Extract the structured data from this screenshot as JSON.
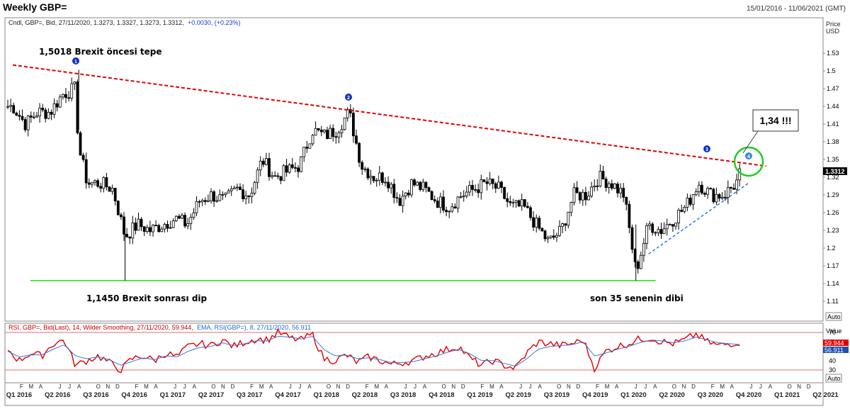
{
  "header": {
    "title": "Weekly GBP=",
    "date_range": "15/01/2016 - 11/06/2021 (GMT)",
    "info_line": "Cndl, GBP=, Bid, 27/11/2020, 1.3273, 1.3327, 1.3273, 1.3312,",
    "info_change": "+0.0030, (+0.23%)",
    "price_axis_label_1": "Price",
    "price_axis_label_2": "USD",
    "auto_label": "Auto"
  },
  "rsi_panel": {
    "info_line": "RSI, GBP=, Bid(Last),  14, Wilder Smoothing, 27/11/2020, 59.944,",
    "ema_line": "EMA, RSI(GBP=),  8, 27/11/2020, 56.911",
    "value_label": "Value",
    "auto_label": "Auto"
  },
  "annotations": {
    "peak_text": "1,5018 Brexit öncesi tepe",
    "dip_text": "1,1450 Brexit sonrası dip",
    "low35_text": "son 35 senenin dibi",
    "callout_text": "1,34 !!!",
    "markers": [
      "1",
      "2",
      "3",
      "4"
    ]
  },
  "colors": {
    "candle": "#000000",
    "resistance": "#e00000",
    "support_blue": "#1f6fd6",
    "support_green": "#33dd33",
    "circle": "#22cc22",
    "marker_blue": "#1030c0",
    "rsi_line": "#e00000",
    "ema_line": "#3a78d8",
    "last_price_bg": "#000000"
  },
  "chart_data": [
    {
      "type": "candlestick",
      "title": "Weekly GBP=",
      "ylabel": "Price USD",
      "y_ticks": [
        "1.53",
        "1.5",
        "1.47",
        "1.44",
        "1.41",
        "1.38",
        "1.35",
        "1.32",
        "1.29",
        "1.26",
        "1.23",
        "1.2",
        "1.17",
        "1.14",
        "1.11"
      ],
      "ylim": [
        1.1,
        1.56
      ],
      "last_price": "1.3312",
      "x_labels": [
        "Q1 2016",
        "F",
        "M",
        "A",
        "Q2 2016",
        "J",
        "J",
        "A",
        "Q3 2016",
        "O",
        "N",
        "D",
        "Q4 2016",
        "F",
        "M",
        "A",
        "Q1 2017",
        "J",
        "J",
        "A",
        "Q2 2017",
        "O",
        "N",
        "D",
        "Q3 2017",
        "F",
        "M",
        "A",
        "Q4 2017",
        "J",
        "J",
        "A",
        "Q1 2018",
        "O",
        "N",
        "D",
        "Q2 2018",
        "F",
        "M",
        "A",
        "Q3 2018",
        "J",
        "J",
        "A",
        "Q4 2018",
        "O",
        "N",
        "D",
        "Q1 2019",
        "F",
        "M",
        "A",
        "Q2 2019",
        "J",
        "J",
        "A",
        "Q3 2019",
        "O",
        "N",
        "D",
        "Q4 2019",
        "F",
        "M",
        "A",
        "Q1 2020",
        "J",
        "J",
        "A",
        "Q2 2020",
        "O",
        "N",
        "D",
        "Q3 2020",
        "F",
        "M",
        "A",
        "Q4 2020",
        "J",
        "J",
        "A",
        "Q1 2021",
        "O",
        "N",
        "D",
        "Q2 2021"
      ],
      "price_path": [
        [
          "2016-01",
          1.44
        ],
        [
          "2016-02",
          1.41
        ],
        [
          "2016-03",
          1.43
        ],
        [
          "2016-04",
          1.43
        ],
        [
          "2016-05",
          1.46
        ],
        [
          "2016-06",
          1.47
        ],
        [
          "2016-06-24",
          1.37
        ],
        [
          "2016-07",
          1.31
        ],
        [
          "2016-08",
          1.31
        ],
        [
          "2016-09",
          1.3
        ],
        [
          "2016-10",
          1.22
        ],
        [
          "2016-11",
          1.24
        ],
        [
          "2016-12",
          1.23
        ],
        [
          "2017-01",
          1.24
        ],
        [
          "2017-02",
          1.25
        ],
        [
          "2017-03",
          1.24
        ],
        [
          "2017-04",
          1.28
        ],
        [
          "2017-05",
          1.29
        ],
        [
          "2017-06",
          1.28
        ],
        [
          "2017-07",
          1.3
        ],
        [
          "2017-08",
          1.29
        ],
        [
          "2017-09",
          1.35
        ],
        [
          "2017-10",
          1.32
        ],
        [
          "2017-11",
          1.33
        ],
        [
          "2017-12",
          1.34
        ],
        [
          "2018-01",
          1.4
        ],
        [
          "2018-02",
          1.39
        ],
        [
          "2018-03",
          1.4
        ],
        [
          "2018-04",
          1.43
        ],
        [
          "2018-05",
          1.34
        ],
        [
          "2018-06",
          1.32
        ],
        [
          "2018-07",
          1.32
        ],
        [
          "2018-08",
          1.28
        ],
        [
          "2018-09",
          1.31
        ],
        [
          "2018-10",
          1.3
        ],
        [
          "2018-11",
          1.28
        ],
        [
          "2018-12",
          1.27
        ],
        [
          "2019-01",
          1.29
        ],
        [
          "2019-02",
          1.3
        ],
        [
          "2019-03",
          1.31
        ],
        [
          "2019-04",
          1.3
        ],
        [
          "2019-05",
          1.27
        ],
        [
          "2019-06",
          1.27
        ],
        [
          "2019-07",
          1.24
        ],
        [
          "2019-08",
          1.21
        ],
        [
          "2019-09",
          1.23
        ],
        [
          "2019-10",
          1.29
        ],
        [
          "2019-11",
          1.29
        ],
        [
          "2019-12",
          1.32
        ],
        [
          "2020-01",
          1.31
        ],
        [
          "2020-02",
          1.29
        ],
        [
          "2020-03",
          1.16
        ],
        [
          "2020-04",
          1.24
        ],
        [
          "2020-05",
          1.23
        ],
        [
          "2020-06",
          1.25
        ],
        [
          "2020-07",
          1.27
        ],
        [
          "2020-08",
          1.31
        ],
        [
          "2020-09",
          1.29
        ],
        [
          "2020-10",
          1.29
        ],
        [
          "2020-11",
          1.31
        ],
        [
          "2020-11-27",
          1.3312
        ]
      ],
      "extremes": {
        "high": 1.5018,
        "low": 1.145
      },
      "trendlines": [
        {
          "style": "dashed-red",
          "from": [
            "2016-01",
            1.51
          ],
          "to": [
            "2020-12",
            1.34
          ]
        },
        {
          "style": "dashed-blue",
          "from": [
            "2020-04",
            1.19
          ],
          "to": [
            "2020-12",
            1.31
          ]
        },
        {
          "style": "solid-green",
          "from": [
            "2016-05",
            1.145
          ],
          "to": [
            "2020-04",
            1.145
          ]
        }
      ]
    },
    {
      "type": "line",
      "title": "RSI",
      "y_ticks": [
        "70",
        "60",
        "40",
        "30"
      ],
      "ylim": [
        20,
        80
      ],
      "reference_lines": [
        70,
        30
      ],
      "series": [
        {
          "name": "RSI",
          "last": "59.944",
          "values": [
            52,
            40,
            48,
            45,
            58,
            62,
            35,
            40,
            45,
            38,
            30,
            42,
            45,
            40,
            48,
            44,
            55,
            58,
            56,
            62,
            55,
            60,
            63,
            62,
            70,
            64,
            62,
            68,
            42,
            40,
            46,
            38,
            44,
            40,
            36,
            38,
            40,
            45,
            48,
            52,
            55,
            42,
            35,
            40,
            35,
            32,
            48,
            60,
            58,
            56,
            58,
            62,
            32,
            50,
            55,
            58,
            63,
            64,
            60,
            58,
            62,
            68,
            60,
            56,
            58,
            60
          ]
        },
        {
          "name": "EMA",
          "last": "56.911",
          "values": [
            50,
            44,
            46,
            46,
            52,
            57,
            45,
            42,
            44,
            41,
            35,
            39,
            43,
            41,
            45,
            44,
            50,
            54,
            55,
            59,
            56,
            58,
            61,
            61,
            66,
            65,
            63,
            66,
            52,
            45,
            46,
            42,
            43,
            41,
            38,
            38,
            39,
            42,
            45,
            49,
            52,
            47,
            40,
            40,
            37,
            34,
            42,
            52,
            55,
            56,
            57,
            60,
            45,
            48,
            52,
            55,
            59,
            62,
            61,
            59,
            61,
            65,
            62,
            59,
            58,
            57
          ]
        }
      ]
    }
  ]
}
